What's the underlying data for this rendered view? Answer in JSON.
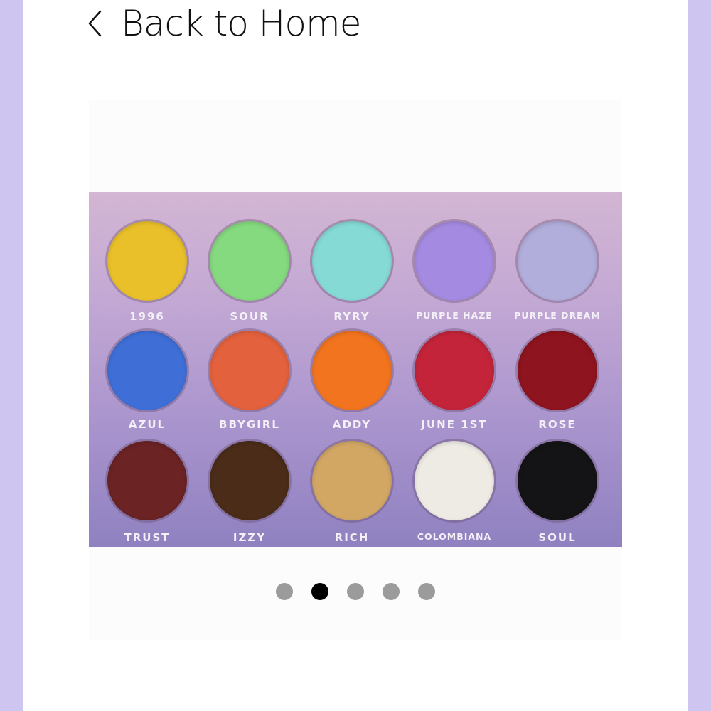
{
  "nav": {
    "back_label": "Back to Home"
  },
  "product": {
    "shades": [
      {
        "name": "1996",
        "color": "#e9c02a"
      },
      {
        "name": "Sour",
        "color": "#85d97e"
      },
      {
        "name": "RyRy",
        "color": "#85dad6"
      },
      {
        "name": "Purple Haze",
        "color": "#a48ae0"
      },
      {
        "name": "Purple Dream",
        "color": "#b2aedc"
      },
      {
        "name": "Azul",
        "color": "#3f6fd6"
      },
      {
        "name": "Bbygirl",
        "color": "#e3613c"
      },
      {
        "name": "Addy",
        "color": "#f2741f"
      },
      {
        "name": "June 1st",
        "color": "#c3243a"
      },
      {
        "name": "Rose",
        "color": "#8e141f"
      },
      {
        "name": "Trust",
        "color": "#6b2324"
      },
      {
        "name": "Izzy",
        "color": "#4a2c18"
      },
      {
        "name": "Rich",
        "color": "#d2a764"
      },
      {
        "name": "Colombiana",
        "color": "#eeeae4"
      },
      {
        "name": "Soul",
        "color": "#141416"
      }
    ]
  },
  "carousel": {
    "total": 5,
    "active_index": 2
  }
}
